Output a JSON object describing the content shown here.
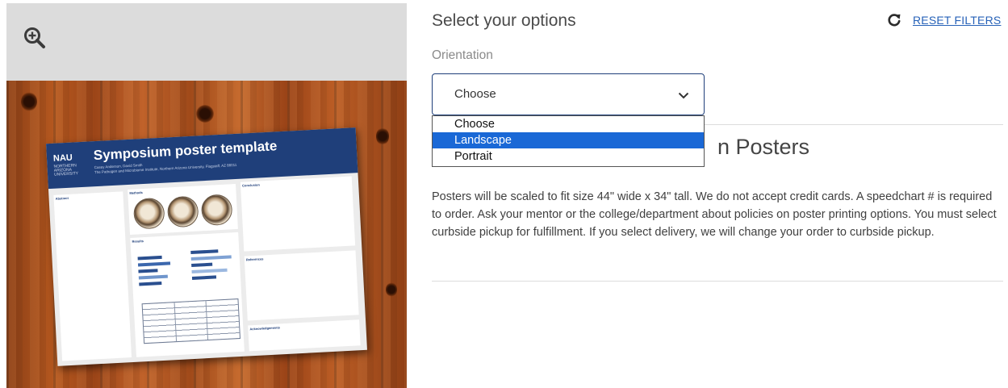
{
  "options": {
    "heading": "Select your options",
    "reset_label": "RESET FILTERS",
    "orientation_label": "Orientation",
    "selected_value": "Choose",
    "dropdown_options": [
      {
        "label": "Choose",
        "selected": false
      },
      {
        "label": "Landscape",
        "selected": true
      },
      {
        "label": "Portrait",
        "selected": false
      }
    ]
  },
  "product": {
    "section_title": "n Posters",
    "description": "Posters will be scaled to fit size 44\" wide x 34\" tall. We do not accept credit cards. A speedchart # is required to order. Ask your mentor or the college/department about policies on poster printing options. You must select curbside pickup for fulfillment. If you select delivery, we will change your order to curbside pickup."
  },
  "poster_preview": {
    "logo_text": "NAU",
    "logo_sub": "NORTHERN ARIZONA UNIVERSITY",
    "title": "Symposium poster template",
    "authors": "Casey Anderson, David Smith",
    "affiliation": "The Pathogen and Microbiome Institute, Northern Arizona University, Flagstaff, AZ 86011",
    "sections": {
      "abstract": "Abstract",
      "methods": "Methods",
      "results": "Results",
      "conclusion": "Conclusion",
      "references": "References",
      "acknowledgements": "Acknowledgements"
    }
  },
  "icons": {
    "zoom": "zoom-in-icon",
    "reset": "refresh-icon",
    "chevron": "chevron-down-icon"
  },
  "colors": {
    "accent": "#1f3f7a",
    "link": "#2762b8",
    "selection": "#1a68d6"
  }
}
